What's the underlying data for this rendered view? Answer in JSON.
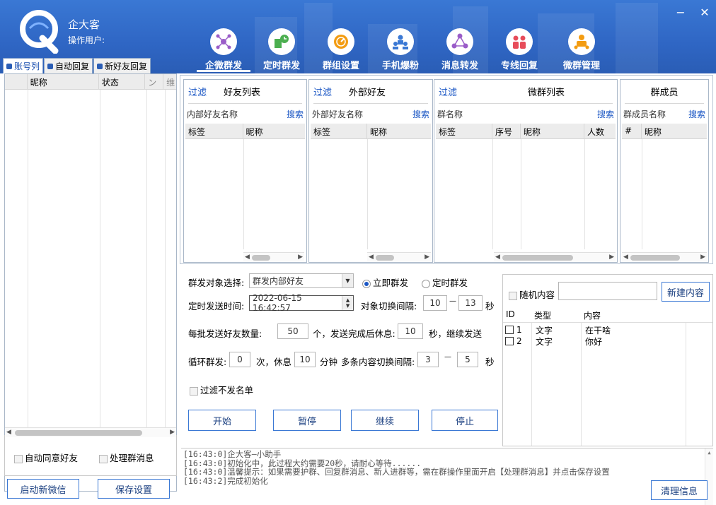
{
  "app": {
    "brand": "企大客",
    "operator_label": "操作用户:"
  },
  "window": {
    "minimize": "−",
    "close": "✕"
  },
  "nav": [
    {
      "label": "企微群发",
      "icon": "network-icon",
      "color": "#9a5cc8",
      "active": true
    },
    {
      "label": "定时群发",
      "icon": "clock-icon",
      "color": "#4caf50"
    },
    {
      "label": "群组设置",
      "icon": "dial-icon",
      "color": "#f39c12"
    },
    {
      "label": "手机爆粉",
      "icon": "users-icon",
      "color": "#3a78d4"
    },
    {
      "label": "消息转发",
      "icon": "share-icon",
      "color": "#9a5cc8"
    },
    {
      "label": "专线回复",
      "icon": "people-icon",
      "color": "#e74c5a"
    },
    {
      "label": "微群管理",
      "icon": "manager-icon",
      "color": "#f39c12"
    }
  ],
  "left": {
    "tabs": [
      "账号列",
      "自动回复",
      "新好友回复"
    ],
    "columns": [
      "昵称",
      "状态",
      "ン",
      "维"
    ],
    "auto_agree": "自动同意好友",
    "handle_group": "处理群消息",
    "btn_new_wechat": "启动新微信",
    "btn_save": "保存设置"
  },
  "panels": {
    "friends": {
      "filter": "过滤",
      "title": "好友列表",
      "search_label": "内部好友名称",
      "search": "搜索",
      "cols": [
        "标签",
        "昵称"
      ]
    },
    "external": {
      "filter": "过滤",
      "title": "外部好友",
      "search_label": "外部好友名称",
      "search": "搜索",
      "cols": [
        "标签",
        "昵称"
      ]
    },
    "groups": {
      "filter": "过滤",
      "title": "微群列表",
      "search_label": "群名称",
      "search": "搜索",
      "cols": [
        "标签",
        "序号",
        "昵称",
        "人数"
      ]
    },
    "members": {
      "title": "群成员",
      "search_label": "群成员名称",
      "search": "搜索",
      "cols": [
        "#",
        "昵称"
      ]
    }
  },
  "form": {
    "target_label": "群发对象选择:",
    "target_value": "群发内部好友",
    "radio_now": "立即群发",
    "radio_timed": "定时群发",
    "time_label": "定时发送时间:",
    "time_value": "2022-06-15 16:42:57",
    "switch_label": "对象切换间隔:",
    "switch_from": "10",
    "switch_dash": "—",
    "switch_to": "13",
    "sec": "秒",
    "batch_label": "每批发送好友数量:",
    "batch_value": "50",
    "batch_mid": "个，发送完成后休息:",
    "rest_value": "10",
    "batch_tail": "秒，继续发送",
    "loop_label": "循环群发:",
    "loop_value": "0",
    "loop_mid": "次，休息",
    "loop_rest": "10",
    "loop_min": "分钟",
    "multi_label": "多条内容切换间隔:",
    "multi_from": "3",
    "multi_dash": "—",
    "multi_to": "5",
    "multi_sec": "秒",
    "filter_blacklist": "过滤不发名单",
    "btn_start": "开始",
    "btn_pause": "暂停",
    "btn_continue": "继续",
    "btn_stop": "停止"
  },
  "content": {
    "random_label": "随机内容",
    "new_btn": "新建内容",
    "cols": [
      "ID",
      "类型",
      "内容"
    ],
    "rows": [
      {
        "id": "1",
        "type": "文字",
        "text": "在干啥"
      },
      {
        "id": "2",
        "type": "文字",
        "text": "你好"
      }
    ]
  },
  "log": {
    "lines": [
      "[16:43:0]企大客—小助手",
      "[16:43:0]初始化中，此过程大约需要20秒，请耐心等待......",
      "[16:43:0]温馨提示：如果需要护群、回复群消息、新人进群等，需在群操作里面开启【处理群消息】并点击保存设置",
      "[16:43:2]完成初始化"
    ],
    "clear_btn": "清理信息"
  }
}
